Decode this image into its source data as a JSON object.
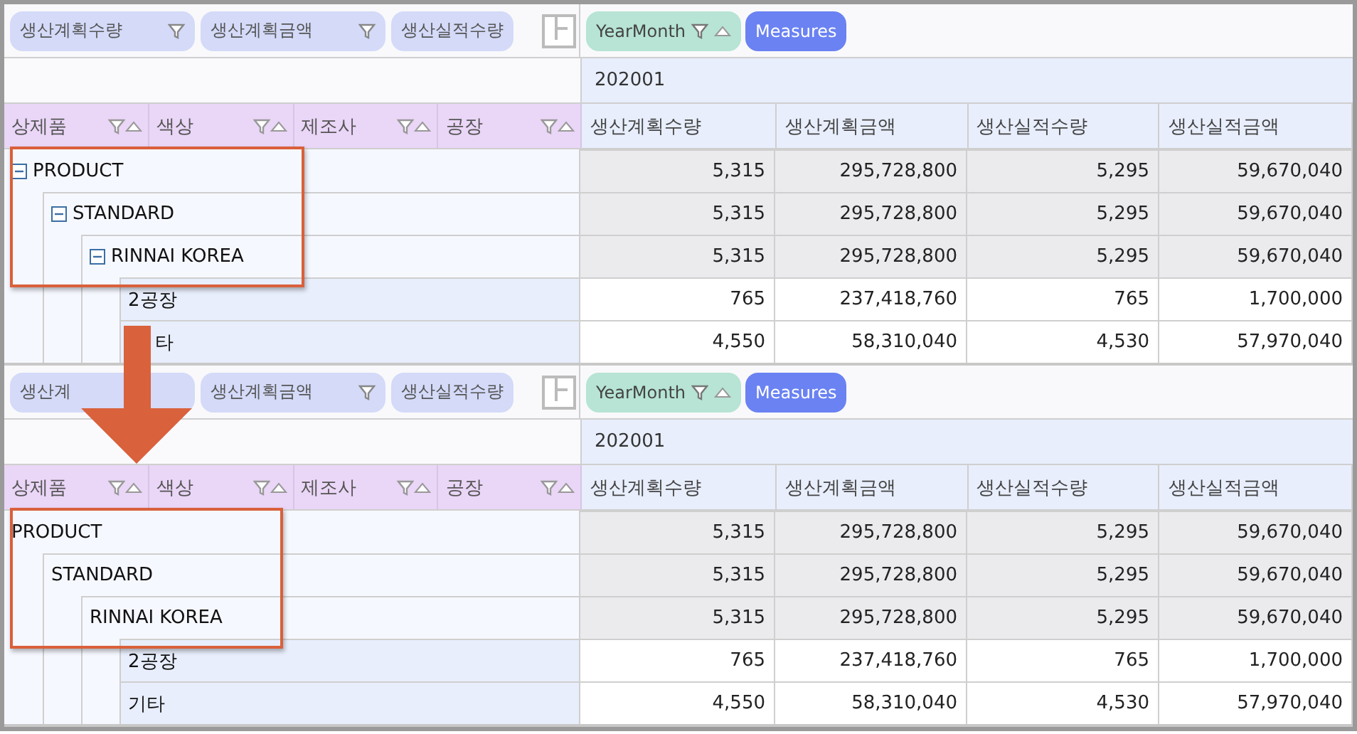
{
  "grids": [
    {
      "row_chips": [
        {
          "label": "생산계획수량"
        },
        {
          "label": "생산계획금액"
        },
        {
          "label": "생산실적수량"
        }
      ],
      "column_chips": [
        {
          "label": "YearMonth",
          "kind": "dimension"
        },
        {
          "label": "Measures",
          "kind": "measures"
        }
      ],
      "period": "202001",
      "row_headers": [
        "상제품",
        "색상",
        "제조사",
        "공장"
      ],
      "measure_headers": [
        "생산계획수량",
        "생산계획금액",
        "생산실적수량",
        "생산실적금액"
      ],
      "rows": [
        {
          "label": "PRODUCT",
          "toggle": true,
          "values": [
            "5,315",
            "295,728,800",
            "5,295",
            "59,670,040"
          ],
          "children": [
            {
              "label": "STANDARD",
              "toggle": true,
              "values": [
                "5,315",
                "295,728,800",
                "5,295",
                "59,670,040"
              ],
              "children": [
                {
                  "label": "RINNAI KOREA",
                  "toggle": true,
                  "values": [
                    "5,315",
                    "295,728,800",
                    "5,295",
                    "59,670,040"
                  ],
                  "children": [
                    {
                      "label": "2공장",
                      "toggle": false,
                      "values": [
                        "765",
                        "237,418,760",
                        "765",
                        "1,700,000"
                      ]
                    },
                    {
                      "label": "타",
                      "toggle": false,
                      "values": [
                        "4,550",
                        "58,310,040",
                        "4,530",
                        "57,970,040"
                      ]
                    }
                  ]
                }
              ]
            }
          ]
        }
      ]
    },
    {
      "row_chips": [
        {
          "label": "생산계"
        },
        {
          "label": "생산계획금액"
        },
        {
          "label": "생산실적수량"
        }
      ],
      "column_chips": [
        {
          "label": "YearMonth",
          "kind": "dimension"
        },
        {
          "label": "Measures",
          "kind": "measures"
        }
      ],
      "period": "202001",
      "row_headers": [
        "상제품",
        "색상",
        "제조사",
        "공장"
      ],
      "measure_headers": [
        "생산계획수량",
        "생산계획금액",
        "생산실적수량",
        "생산실적금액"
      ],
      "rows": [
        {
          "label": "PRODUCT",
          "toggle": false,
          "values": [
            "5,315",
            "295,728,800",
            "5,295",
            "59,670,040"
          ],
          "children": [
            {
              "label": "STANDARD",
              "toggle": false,
              "values": [
                "5,315",
                "295,728,800",
                "5,295",
                "59,670,040"
              ],
              "children": [
                {
                  "label": "RINNAI KOREA",
                  "toggle": false,
                  "values": [
                    "5,315",
                    "295,728,800",
                    "5,295",
                    "59,670,040"
                  ],
                  "children": [
                    {
                      "label": "2공장",
                      "toggle": false,
                      "values": [
                        "765",
                        "237,418,760",
                        "765",
                        "1,700,000"
                      ]
                    },
                    {
                      "label": "기타",
                      "toggle": false,
                      "values": [
                        "4,550",
                        "58,310,040",
                        "4,530",
                        "57,970,040"
                      ]
                    }
                  ]
                }
              ]
            }
          ]
        }
      ]
    }
  ]
}
